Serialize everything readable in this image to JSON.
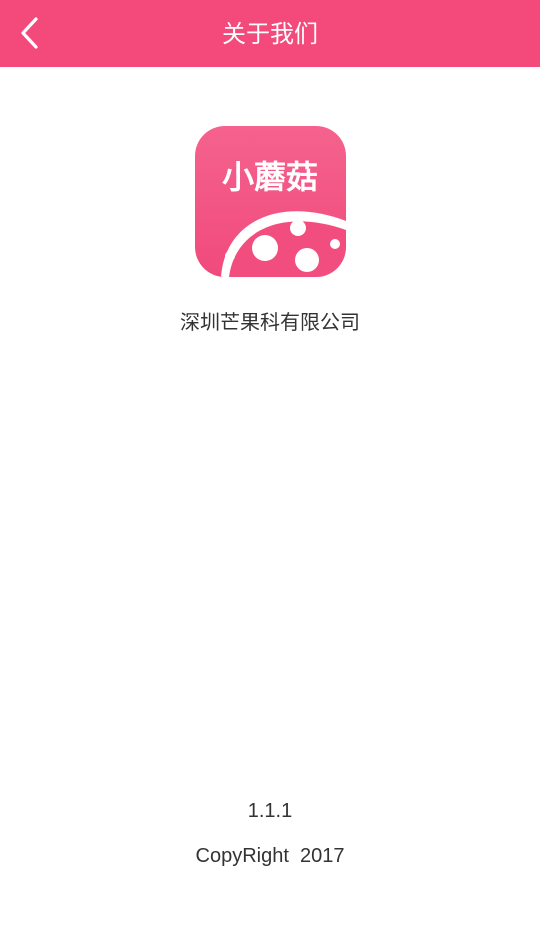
{
  "header": {
    "title": "关于我们",
    "back_icon": "chevron-left-icon",
    "background_color": "#f4497b"
  },
  "logo": {
    "text": "小蘑菇",
    "icon": "mushroom-logo",
    "color": "#f4497b"
  },
  "company_name": "深圳芒果科有限公司",
  "footer": {
    "version": "1.1.1",
    "copyright": "CopyRight  2017"
  }
}
